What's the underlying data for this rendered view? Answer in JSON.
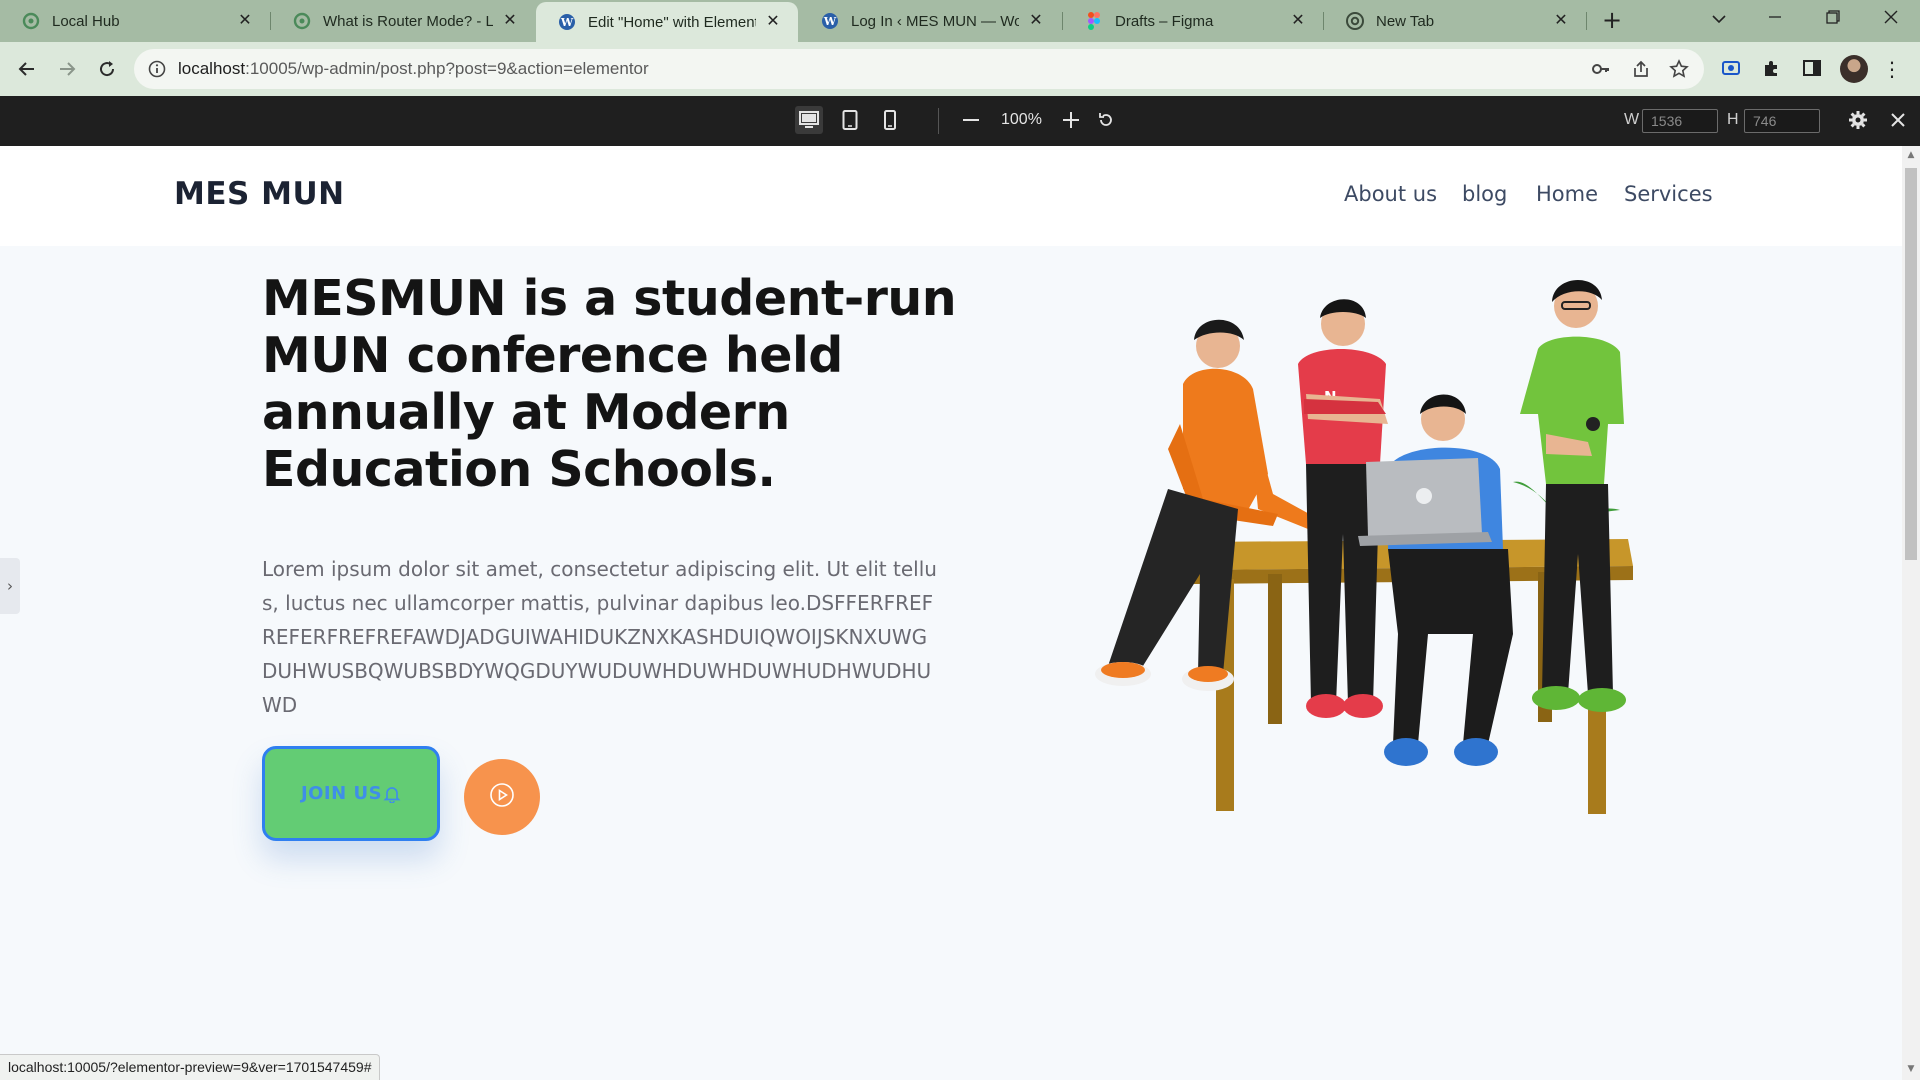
{
  "browser": {
    "tabs": [
      {
        "title": "Local Hub",
        "icon": "local-hub-icon"
      },
      {
        "title": "What is Router Mode? - Lo",
        "icon": "local-hub-icon"
      },
      {
        "title": "Edit \"Home\" with Elemento",
        "icon": "wordpress-icon",
        "active": true
      },
      {
        "title": "Log In ‹ MES MUN — Wor",
        "icon": "wordpress-icon"
      },
      {
        "title": "Drafts – Figma",
        "icon": "figma-icon"
      },
      {
        "title": "New Tab",
        "icon": "chrome-icon"
      }
    ],
    "url_host": "localhost",
    "url_rest": ":10005/wp-admin/post.php?post=9&action=elementor",
    "status_url": "localhost:10005/?elementor-preview=9&ver=1701547459#"
  },
  "responsive_bar": {
    "zoom": "100%",
    "width_label": "W",
    "width_value": "1536",
    "height_label": "H",
    "height_value": "746"
  },
  "site": {
    "logo": "MES MUN",
    "menu": [
      "About us",
      "blog",
      "Home",
      "Services"
    ],
    "hero_title": "MESMUN is a student-run MUN conference held annually at Modern Education Schools.",
    "hero_text": "Lorem ipsum dolor sit amet, consectetur adipiscing elit. Ut elit tellus, luctus nec ullamcorper mattis, pulvinar dapibus leo.DSFFERFREFREFERFREFREFAWDJADGUIWAHIDUKZNXKASHDUIQWOIJSKNXUWGDUHWUSBQWUBSBDYWQGDUYWUDUWHDUWHDUWHUDHWUDHUWD",
    "join_button": "JOIN US",
    "colors": {
      "join_bg": "#63cc74",
      "join_border": "#2f7ff0",
      "play_bg": "#f7934d",
      "canvas_bg": "#f6f9fc"
    }
  }
}
